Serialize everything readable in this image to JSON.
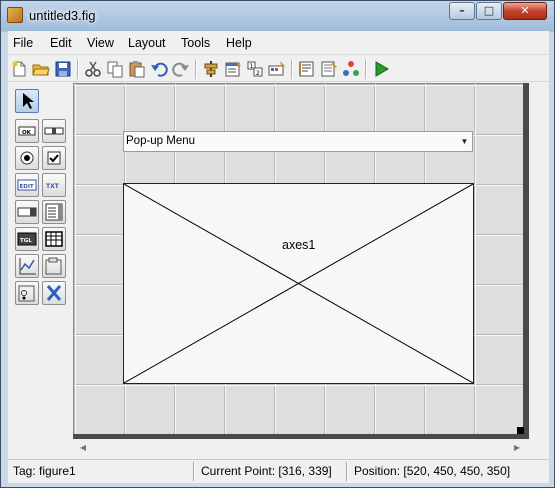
{
  "window": {
    "title": "untitled3.fig",
    "controls": {
      "minimize": "–",
      "maximize": "□",
      "close": "✕"
    }
  },
  "menubar": {
    "items": [
      {
        "label": "File"
      },
      {
        "label": "Edit"
      },
      {
        "label": "View"
      },
      {
        "label": "Layout"
      },
      {
        "label": "Tools"
      },
      {
        "label": "Help"
      }
    ]
  },
  "toolbar": {
    "icons": [
      "new-file-icon",
      "open-folder-icon",
      "save-icon",
      "cut-icon",
      "copy-icon",
      "paste-icon",
      "undo-icon",
      "redo-icon",
      "align-objects-icon",
      "menu-editor-icon",
      "tab-order-editor-icon",
      "toolbar-editor-icon",
      "mfile-editor-icon",
      "property-inspector-icon",
      "object-browser-icon",
      "run-figure-icon"
    ]
  },
  "palette": {
    "tools": [
      "select-tool-icon",
      "push-button-icon",
      "slider-icon",
      "radio-button-icon",
      "checkbox-icon",
      "edit-text-icon",
      "static-text-icon",
      "popup-menu-icon",
      "listbox-icon",
      "toggle-button-icon",
      "table-icon",
      "axes-icon",
      "panel-icon",
      "button-group-icon",
      "activex-control-icon"
    ]
  },
  "canvas": {
    "popup_menu_label": "Pop-up Menu",
    "axes_label": "axes1"
  },
  "statusbar": {
    "tag": "Tag: figure1",
    "current_point": "Current Point:  [316, 339]",
    "position": "Position: [520, 450, 450, 350]"
  },
  "colors": {
    "title_gradient_top": "#c3d6ea",
    "close_button": "#c4442b",
    "grid_background": "#dedede",
    "run_green": "#2a9d2a"
  }
}
